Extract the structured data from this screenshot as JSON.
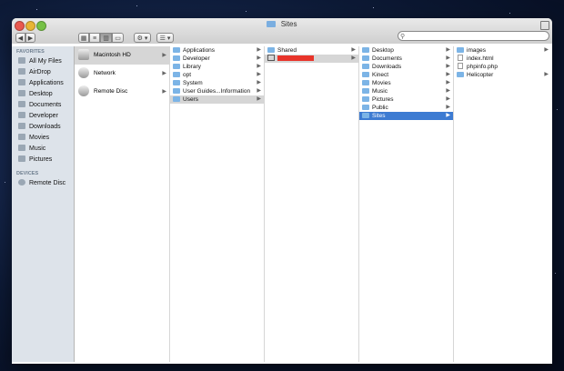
{
  "window": {
    "title": "Sites"
  },
  "toolbar": {
    "back_label": "◀",
    "forward_label": "▶",
    "action_label": "⚙ ▾",
    "arrange_label": "☰ ▾",
    "search_placeholder": ""
  },
  "sidebar": {
    "favorites_header": "FAVORITES",
    "favorites": [
      {
        "label": "All My Files",
        "icon": "files-icon"
      },
      {
        "label": "AirDrop",
        "icon": "airdrop-icon"
      },
      {
        "label": "Applications",
        "icon": "applications-icon"
      },
      {
        "label": "Desktop",
        "icon": "desktop-icon"
      },
      {
        "label": "Documents",
        "icon": "documents-icon"
      },
      {
        "label": "Developer",
        "icon": "folder-icon"
      },
      {
        "label": "Downloads",
        "icon": "downloads-icon"
      },
      {
        "label": "Movies",
        "icon": "movies-icon"
      },
      {
        "label": "Music",
        "icon": "music-icon"
      },
      {
        "label": "Pictures",
        "icon": "pictures-icon"
      }
    ],
    "devices_header": "DEVICES",
    "devices": [
      {
        "label": "Remote Disc",
        "icon": "disc-icon"
      }
    ]
  },
  "columns": {
    "col1": [
      "Macintosh HD",
      "Network",
      "Remote Disc"
    ],
    "col2": [
      "Applications",
      "Developer",
      "Library",
      "opt",
      "System",
      "User Guides...Information",
      "Users"
    ],
    "col3": [
      "Shared",
      ""
    ],
    "col4": [
      "Desktop",
      "Documents",
      "Downloads",
      "Kinect",
      "Movies",
      "Music",
      "Pictures",
      "Public",
      "Sites"
    ],
    "col5": [
      "images",
      "index.html",
      "phpinfo.php",
      "Helicopter"
    ]
  },
  "colors": {
    "selection": "#3d7bd2",
    "redaction": "#e8342a"
  }
}
